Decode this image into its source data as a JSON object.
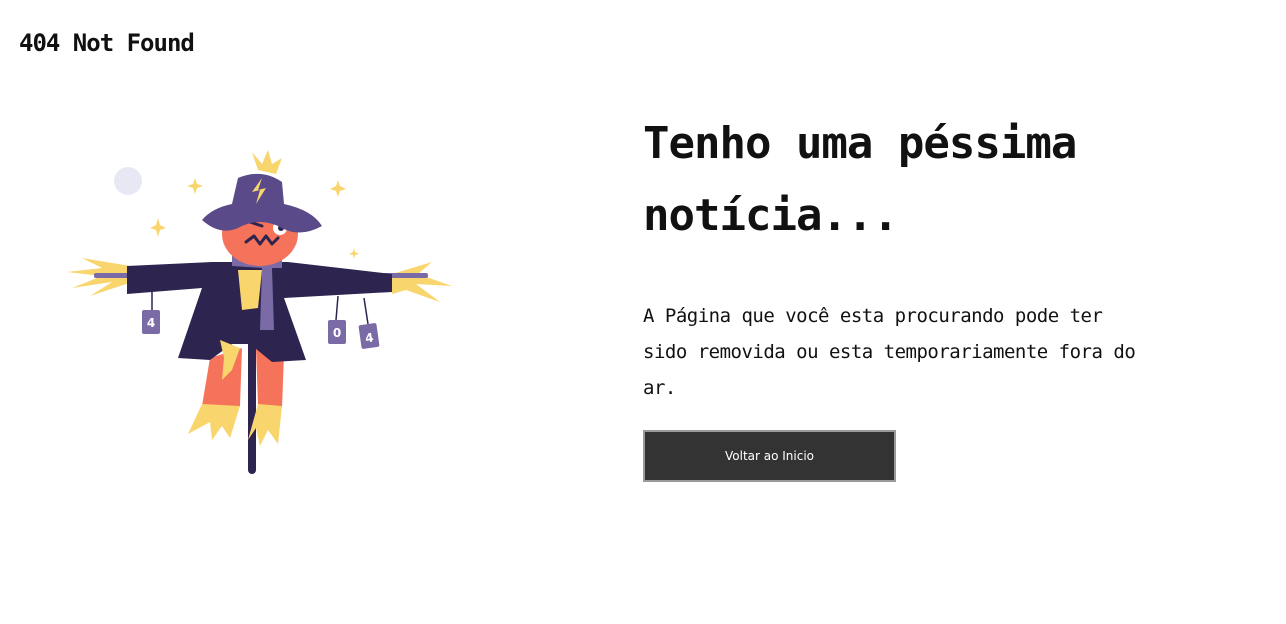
{
  "header": {
    "title": "404 Not Found"
  },
  "illustration": {
    "icon": "scarecrow-illustration",
    "cans": [
      "4",
      "0",
      "4"
    ]
  },
  "main": {
    "headline": "Tenho uma péssima notícia...",
    "message": "A Página que você esta procurando pode ter sido removida ou esta temporariamente fora do ar.",
    "button_label": "Voltar ao Inicio"
  },
  "colors": {
    "button_bg": "#333333",
    "button_border": "#9a9a9a",
    "text": "#111111",
    "hat": "#5a4a8a",
    "coat": "#2e2450",
    "pumpkin": "#f4735a",
    "straw": "#f9d56e",
    "scarf": "#7a6aa6"
  }
}
